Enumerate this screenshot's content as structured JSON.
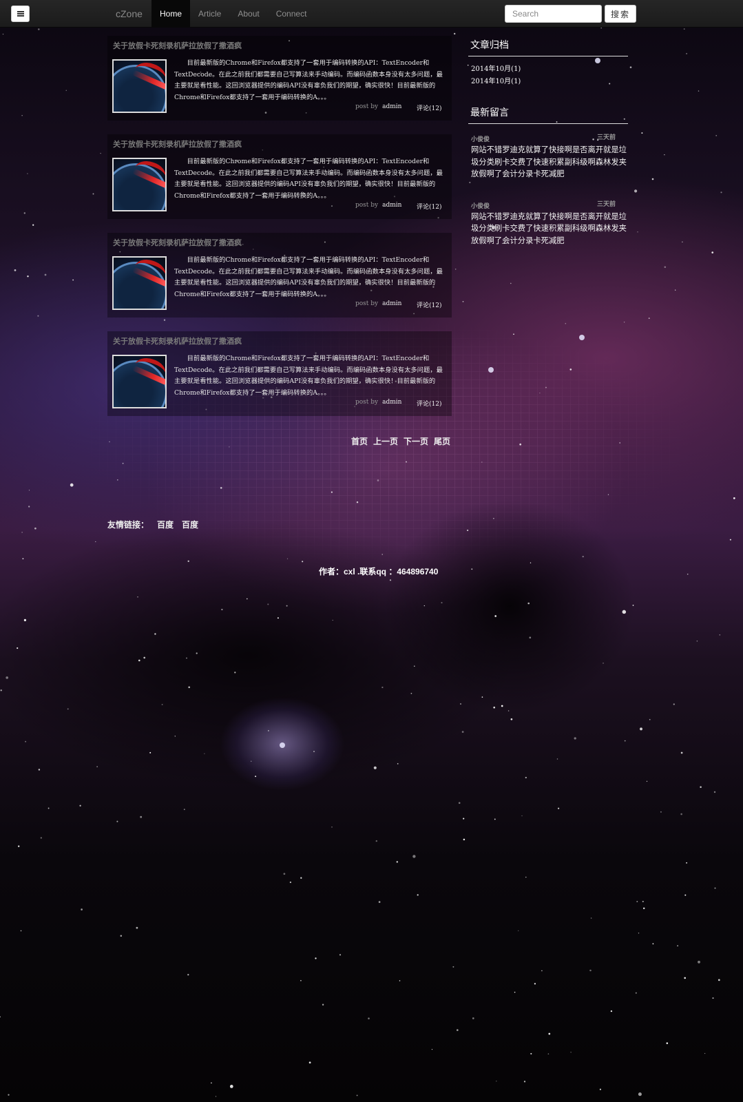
{
  "navbar": {
    "brand": "cZone",
    "items": [
      {
        "label": "Home",
        "active": true
      },
      {
        "label": "Article",
        "active": false
      },
      {
        "label": "About",
        "active": false
      },
      {
        "label": "Connect",
        "active": false
      }
    ],
    "search_placeholder": "Search",
    "search_button": "搜索",
    "menu_icon": "hamburger-icon"
  },
  "posts": [
    {
      "title": "关于放假卡死刻录机萨拉放假了撒酒疯",
      "thumbnail_icon": "speedometer-image",
      "excerpt": "目前最新版的Chrome和Firefox都支持了一套用于编码转换的API：TextEncoder和TextDecode。在此之前我们都需要自己写算法来手动编码。而编码函数本身没有太多问题，最主要就是看性能。这回浏览器提供的编码API没有辜负我们的期望，确实很快！目前最新版的Chrome和Firefox都支持了一套用于编码转换的A。。。",
      "post_by": "post by",
      "author": "admin",
      "comments": "评论(12)"
    },
    {
      "title": "关于放假卡死刻录机萨拉放假了撒酒疯",
      "thumbnail_icon": "speedometer-image",
      "excerpt": "目前最新版的Chrome和Firefox都支持了一套用于编码转换的API：TextEncoder和TextDecode。在此之前我们都需要自己写算法来手动编码。而编码函数本身没有太多问题，最主要就是看性能。这回浏览器提供的编码API没有辜负我们的期望，确实很快！目前最新版的Chrome和Firefox都支持了一套用于编码转换的A。。。",
      "post_by": "post by",
      "author": "admin",
      "comments": "评论(12)"
    },
    {
      "title": "关于放假卡死刻录机萨拉放假了撒酒疯",
      "thumbnail_icon": "speedometer-image",
      "excerpt": "目前最新版的Chrome和Firefox都支持了一套用于编码转换的API：TextEncoder和TextDecode。在此之前我们都需要自己写算法来手动编码。而编码函数本身没有太多问题，最主要就是看性能。这回浏览器提供的编码API没有辜负我们的期望，确实很快！目前最新版的Chrome和Firefox都支持了一套用于编码转换的A。。。",
      "post_by": "post by",
      "author": "admin",
      "comments": "评论(12)"
    },
    {
      "title": "关于放假卡死刻录机萨拉放假了撒酒疯",
      "thumbnail_icon": "speedometer-image",
      "excerpt": "目前最新版的Chrome和Firefox都支持了一套用于编码转换的API：TextEncoder和TextDecode。在此之前我们都需要自己写算法来手动编码。而编码函数本身没有太多问题，最主要就是看性能。这回浏览器提供的编码API没有辜负我们的期望，确实很快！目前最新版的Chrome和Firefox都支持了一套用于编码转换的A。。。",
      "post_by": "post by",
      "author": "admin",
      "comments": "评论(12)"
    }
  ],
  "pager": {
    "first": "首页",
    "prev": "上一页",
    "next": "下一页",
    "last": "尾页"
  },
  "sidebar": {
    "archive_title": "文章归档",
    "archive_items": [
      "2014年10月(1)",
      "2014年10月(1)"
    ],
    "comments_title": "最新留言",
    "comments": [
      {
        "user": "小俊俊",
        "time": "三天前",
        "text": "网站不错罗迪克就算了快接啊是否离开就是垃圾分类刷卡交费了快速积累副科级啊森林发夹放假啊了会计分录卡死减肥"
      },
      {
        "user": "小俊俊",
        "time": "三天前",
        "text": "网站不错罗迪克就算了快接啊是否离开就是垃圾分类刷卡交费了快速积累副科级啊森林发夹放假啊了会计分录卡死减肥"
      }
    ]
  },
  "friend_links": {
    "label": "友情链接：",
    "links": [
      "百度",
      "百度"
    ]
  },
  "footer": {
    "text": "作者：cxl .联系qq ：464896740"
  }
}
